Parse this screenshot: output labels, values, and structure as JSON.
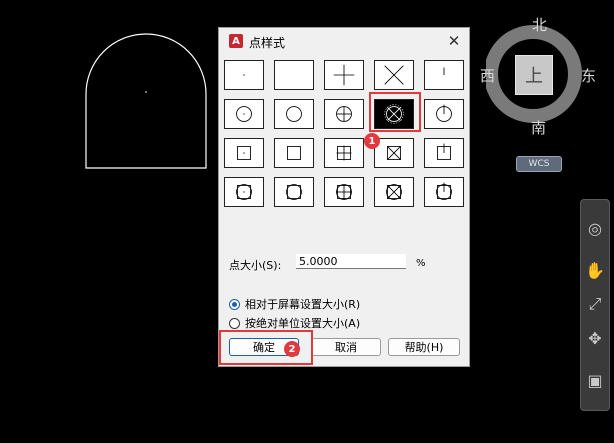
{
  "dialog": {
    "app_icon": "A",
    "title": "点样式",
    "close_icon": "✕",
    "point_styles": [
      "dot",
      "none",
      "plus",
      "cross",
      "tick",
      "circle-dot",
      "circle",
      "circle-plus",
      "circle-cross",
      "circle-tick",
      "square-dot",
      "square",
      "square-plus",
      "square-cross",
      "square-tick",
      "circsq-dot",
      "circsq",
      "circsq-plus",
      "circsq-cross",
      "circsq-tick"
    ],
    "selected_index": 8,
    "size_label": "点大小(S):",
    "size_value": "5.0000",
    "size_unit": "%",
    "radio_relative": "相对于屏幕设置大小(R)",
    "radio_absolute": "按绝对单位设置大小(A)",
    "relative_selected": true,
    "ok_label": "确定",
    "cancel_label": "取消",
    "help_label": "帮助(H)"
  },
  "markers": [
    "1",
    "2"
  ],
  "viewcube": {
    "north": "北",
    "south": "南",
    "east": "东",
    "west": "西",
    "top_face": "上",
    "wcs_label": "WCS"
  },
  "navbar_icons": [
    "steering-wheel-icon",
    "pan-icon",
    "zoom-icon",
    "orbit-icon",
    "showmotion-icon"
  ],
  "colors": {
    "background": "#000000",
    "accent_red": "#e0393e",
    "drawing_line": "#ffffff"
  }
}
